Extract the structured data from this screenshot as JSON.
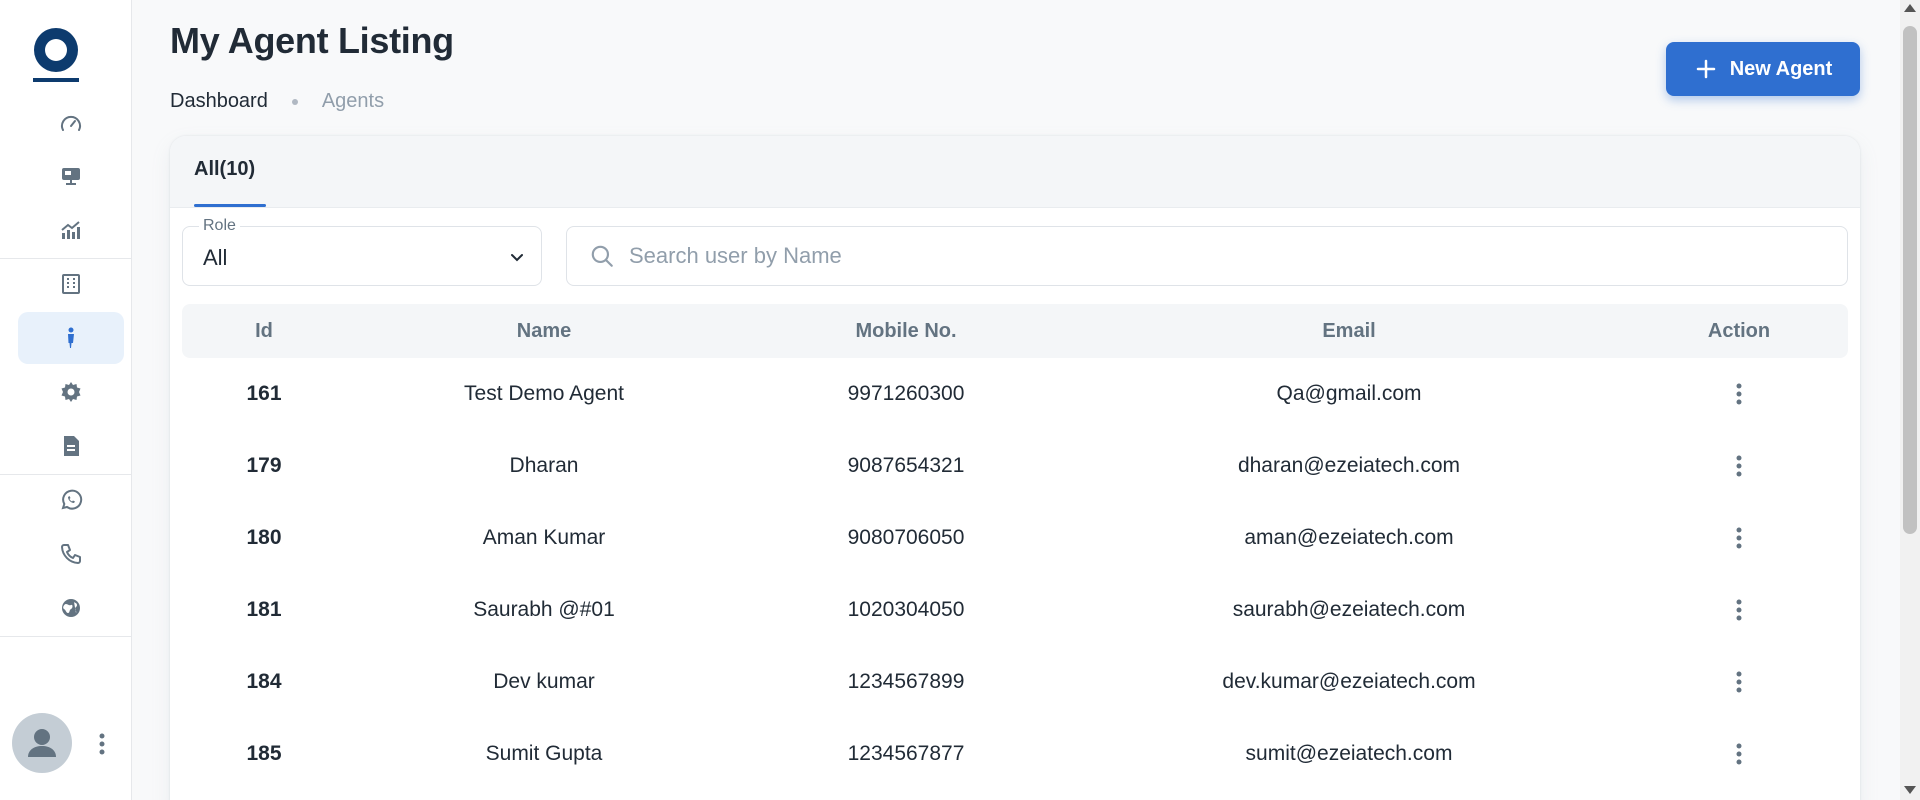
{
  "sidebar": {
    "logo": "brand-logo",
    "items": [
      {
        "icon": "dashboard-gauge-icon",
        "active": false
      },
      {
        "icon": "monitor-icon",
        "active": false
      },
      {
        "icon": "analytics-chart-icon",
        "active": false
      },
      {
        "icon": "building-icon",
        "active": false
      },
      {
        "icon": "agent-person-icon",
        "active": true
      },
      {
        "icon": "settings-gear-icon",
        "active": false
      },
      {
        "icon": "document-icon",
        "active": false
      },
      {
        "icon": "whatsapp-icon",
        "active": false
      },
      {
        "icon": "phone-icon",
        "active": false
      },
      {
        "icon": "globe-icon",
        "active": false
      }
    ]
  },
  "header": {
    "title": "My Agent Listing",
    "breadcrumb": {
      "dashboard": "Dashboard",
      "agents": "Agents"
    },
    "new_agent_label": "New Agent"
  },
  "tabs": [
    {
      "label": "All(10)",
      "active": true
    }
  ],
  "filters": {
    "role_label": "Role",
    "role_value": "All",
    "search_placeholder": "Search user by Name"
  },
  "table": {
    "columns": [
      "Id",
      "Name",
      "Mobile No.",
      "Email",
      "Action"
    ],
    "rows": [
      {
        "id": "161",
        "name": "Test Demo Agent",
        "mobile": "9971260300",
        "email": "Qa@gmail.com"
      },
      {
        "id": "179",
        "name": "Dharan",
        "mobile": "9087654321",
        "email": "dharan@ezeiatech.com"
      },
      {
        "id": "180",
        "name": "Aman Kumar",
        "mobile": "9080706050",
        "email": "aman@ezeiatech.com"
      },
      {
        "id": "181",
        "name": "Saurabh @#01",
        "mobile": "1020304050",
        "email": "saurabh@ezeiatech.com"
      },
      {
        "id": "184",
        "name": "Dev kumar",
        "mobile": "1234567899",
        "email": "dev.kumar@ezeiatech.com"
      },
      {
        "id": "185",
        "name": "Sumit Gupta",
        "mobile": "1234567877",
        "email": "sumit@ezeiatech.com"
      }
    ]
  },
  "colors": {
    "accent": "#2f6fd0",
    "brand_dark": "#0d3b6e",
    "icon": "#637381",
    "active_bg": "#e8f1fb"
  }
}
